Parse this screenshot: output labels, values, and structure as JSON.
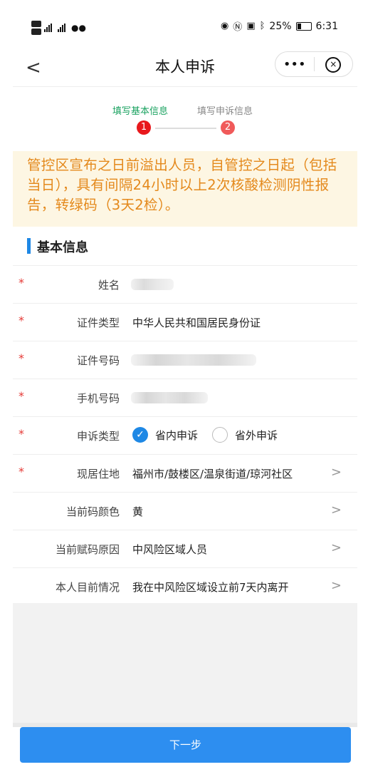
{
  "status_bar": {
    "hd1": "HD 1",
    "hd2": "HD 2",
    "net1": "46",
    "net2": "46",
    "battery": "25%",
    "time": "6:31",
    "icons": [
      "eye-icon",
      "nfc-icon",
      "vibrate-icon",
      "bluetooth-icon",
      "battery-icon"
    ]
  },
  "nav": {
    "back": "<",
    "title": "本人申诉",
    "more": "•••",
    "close": "×"
  },
  "steps": [
    {
      "label": "填写基本信息",
      "num": "1",
      "active": true
    },
    {
      "label": "填写申诉信息",
      "num": "2",
      "active": false
    }
  ],
  "notice": "管控区宣布之日前溢出人员，自管控之日起（包括当日），具有间隔24小时以上2次核酸检测阴性报告，转绿码（3天2检）。",
  "section_title": "基本信息",
  "fields": {
    "name": {
      "label": "姓名",
      "required": "*"
    },
    "id_type": {
      "label": "证件类型",
      "value": "中华人民共和国居民身份证",
      "required": "*"
    },
    "id_number": {
      "label": "证件号码",
      "required": "*"
    },
    "phone": {
      "label": "手机号码",
      "required": "*"
    },
    "appeal_type": {
      "label": "申诉类型",
      "required": "*",
      "options": [
        "省内申诉",
        "省外申诉"
      ],
      "selected": "省内申诉"
    },
    "address": {
      "label": "现居住地",
      "value": "福州市/鼓楼区/温泉街道/琼河社区",
      "required": "*"
    },
    "code_color": {
      "label": "当前码颜色",
      "value": "黄"
    },
    "code_reason": {
      "label": "当前赋码原因",
      "value": "中风险区域人员"
    },
    "situation": {
      "label": "本人目前情况",
      "value": "我在中风险区域设立前7天内离开"
    }
  },
  "arrow": ">",
  "next_button": "下一步",
  "colors": {
    "accent": "#2d8ef0",
    "step_active": "#1aa260",
    "step_dot": "#e8181c",
    "notice_text": "#e4891c",
    "notice_bg": "#fdf6e3",
    "required": "#e53935"
  }
}
